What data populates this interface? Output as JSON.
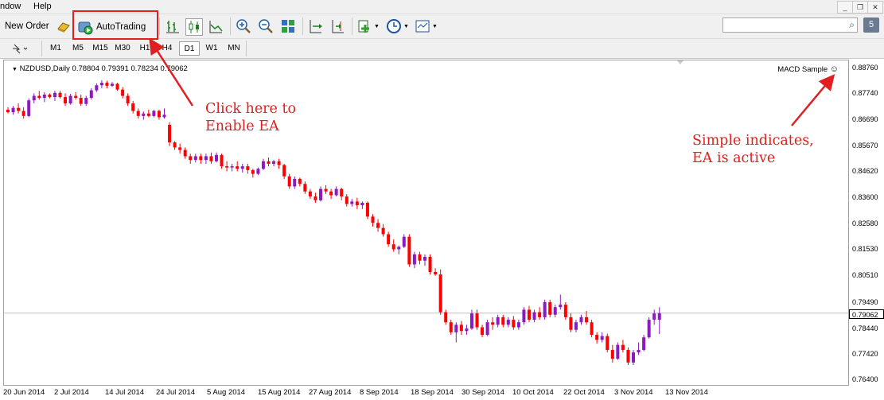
{
  "menu": {
    "items": [
      "ndow",
      "Help"
    ]
  },
  "toolbar": {
    "new_order_label": "New Order",
    "autotrading_label": "AutoTrading",
    "icons": [
      "gold-bars-icon",
      "bar-chart-icon",
      "candlestick-chart-icon",
      "line-chart-icon",
      "zoom-in-icon",
      "zoom-out-icon",
      "tile-windows-icon",
      "chart-shift-icon",
      "autoscroll-icon",
      "indicators-icon",
      "periods-clock-icon",
      "templates-icon"
    ],
    "search_placeholder": "",
    "notification_count": "5"
  },
  "timeframes": {
    "items": [
      "M1",
      "M5",
      "M15",
      "M30",
      "H1",
      "H4",
      "D1",
      "W1",
      "MN"
    ],
    "active": "D1"
  },
  "chart": {
    "symbol_info": "NZDUSD,Daily  0.78804  0.79391  0.78234  0.79062",
    "ea_label": "MACD Sample",
    "current_price": "0.79062",
    "colors": {
      "up": "#8b1ac2",
      "down": "#ff0000",
      "price_line": "#c0c0c0"
    }
  },
  "x_axis_labels": [
    "20 Jun 2014",
    "2 Jul 2014",
    "14 Jul 2014",
    "24 Jul 2014",
    "5 Aug 2014",
    "15 Aug 2014",
    "27 Aug 2014",
    "8 Sep 2014",
    "18 Sep 2014",
    "30 Sep 2014",
    "10 Oct 2014",
    "22 Oct 2014",
    "3 Nov 2014",
    "13 Nov 2014"
  ],
  "y_axis_labels": [
    "0.88760",
    "0.87740",
    "0.86690",
    "0.85670",
    "0.84620",
    "0.83600",
    "0.82580",
    "0.81530",
    "0.80510",
    "0.79490",
    "0.78440",
    "0.77420",
    "0.76400"
  ],
  "annotations": {
    "click_here_line1": "Click here to",
    "click_here_line2": "Enable EA",
    "simple_line1": "Simple indicates,",
    "simple_line2": "EA is active"
  },
  "candles": [
    [
      0.8715,
      0.8725,
      0.87,
      0.8705
    ],
    [
      0.8705,
      0.873,
      0.8695,
      0.8722
    ],
    [
      0.8722,
      0.874,
      0.87,
      0.871
    ],
    [
      0.871,
      0.8725,
      0.868,
      0.869
    ],
    [
      0.869,
      0.876,
      0.8685,
      0.8752
    ],
    [
      0.8752,
      0.878,
      0.874,
      0.877
    ],
    [
      0.877,
      0.879,
      0.8755,
      0.8762
    ],
    [
      0.8762,
      0.8785,
      0.8745,
      0.8775
    ],
    [
      0.8775,
      0.878,
      0.876,
      0.8765
    ],
    [
      0.8765,
      0.879,
      0.875,
      0.8782
    ],
    [
      0.8782,
      0.879,
      0.876,
      0.8765
    ],
    [
      0.8765,
      0.878,
      0.873,
      0.874
    ],
    [
      0.874,
      0.8778,
      0.8735,
      0.877
    ],
    [
      0.877,
      0.8785,
      0.8755,
      0.8762
    ],
    [
      0.8762,
      0.8775,
      0.873,
      0.8738
    ],
    [
      0.8738,
      0.877,
      0.873,
      0.8762
    ],
    [
      0.8762,
      0.88,
      0.8755,
      0.8792
    ],
    [
      0.8792,
      0.882,
      0.8785,
      0.8812
    ],
    [
      0.8812,
      0.8832,
      0.88,
      0.8822
    ],
    [
      0.8822,
      0.883,
      0.88,
      0.881
    ],
    [
      0.881,
      0.8825,
      0.8805,
      0.8818
    ],
    [
      0.8818,
      0.8822,
      0.879,
      0.8795
    ],
    [
      0.8795,
      0.8805,
      0.876,
      0.877
    ],
    [
      0.877,
      0.878,
      0.873,
      0.874
    ],
    [
      0.874,
      0.875,
      0.87,
      0.871
    ],
    [
      0.871,
      0.872,
      0.868,
      0.869
    ],
    [
      0.869,
      0.8708,
      0.8675,
      0.87
    ],
    [
      0.87,
      0.8715,
      0.8685,
      0.869
    ],
    [
      0.869,
      0.8715,
      0.8685,
      0.871
    ],
    [
      0.871,
      0.8715,
      0.8675,
      0.8685
    ],
    [
      0.8685,
      0.872,
      0.868,
      0.8695
    ],
    [
      0.8655,
      0.8665,
      0.857,
      0.8585
    ],
    [
      0.8585,
      0.859,
      0.8555,
      0.8565
    ],
    [
      0.8565,
      0.858,
      0.854,
      0.8555
    ],
    [
      0.8555,
      0.8565,
      0.852,
      0.853
    ],
    [
      0.853,
      0.854,
      0.85,
      0.8515
    ],
    [
      0.8515,
      0.854,
      0.8505,
      0.853
    ],
    [
      0.853,
      0.854,
      0.85,
      0.8515
    ],
    [
      0.8515,
      0.854,
      0.85,
      0.853
    ],
    [
      0.853,
      0.8545,
      0.85,
      0.851
    ],
    [
      0.851,
      0.8545,
      0.8505,
      0.8535
    ],
    [
      0.8535,
      0.854,
      0.848,
      0.849
    ],
    [
      0.849,
      0.851,
      0.847,
      0.8485
    ],
    [
      0.8485,
      0.85,
      0.847,
      0.849
    ],
    [
      0.849,
      0.851,
      0.847,
      0.848
    ],
    [
      0.848,
      0.85,
      0.8465,
      0.849
    ],
    [
      0.849,
      0.85,
      0.846,
      0.8475
    ],
    [
      0.8475,
      0.848,
      0.8445,
      0.846
    ],
    [
      0.846,
      0.8485,
      0.8455,
      0.848
    ],
    [
      0.848,
      0.852,
      0.8475,
      0.851
    ],
    [
      0.851,
      0.8525,
      0.849,
      0.85
    ],
    [
      0.85,
      0.8515,
      0.849,
      0.851
    ],
    [
      0.851,
      0.852,
      0.848,
      0.8495
    ],
    [
      0.8495,
      0.85,
      0.844,
      0.845
    ],
    [
      0.845,
      0.846,
      0.84,
      0.841
    ],
    [
      0.841,
      0.845,
      0.84,
      0.844
    ],
    [
      0.844,
      0.8445,
      0.841,
      0.842
    ],
    [
      0.842,
      0.843,
      0.838,
      0.839
    ],
    [
      0.839,
      0.84,
      0.836,
      0.837
    ],
    [
      0.837,
      0.8385,
      0.8345,
      0.8355
    ],
    [
      0.8355,
      0.841,
      0.835,
      0.84
    ],
    [
      0.84,
      0.8415,
      0.838,
      0.839
    ],
    [
      0.839,
      0.84,
      0.836,
      0.8375
    ],
    [
      0.8375,
      0.841,
      0.837,
      0.84
    ],
    [
      0.84,
      0.8405,
      0.8355,
      0.837
    ],
    [
      0.837,
      0.838,
      0.833,
      0.834
    ],
    [
      0.834,
      0.836,
      0.833,
      0.835
    ],
    [
      0.835,
      0.8365,
      0.832,
      0.8335
    ],
    [
      0.8335,
      0.835,
      0.832,
      0.8345
    ],
    [
      0.8345,
      0.835,
      0.828,
      0.829
    ],
    [
      0.829,
      0.83,
      0.825,
      0.8265
    ],
    [
      0.8265,
      0.828,
      0.823,
      0.8245
    ],
    [
      0.8245,
      0.826,
      0.821,
      0.822
    ],
    [
      0.822,
      0.823,
      0.817,
      0.818
    ],
    [
      0.818,
      0.82,
      0.815,
      0.816
    ],
    [
      0.816,
      0.8175,
      0.814,
      0.817
    ],
    [
      0.817,
      0.822,
      0.8165,
      0.821
    ],
    [
      0.821,
      0.822,
      0.809,
      0.81
    ],
    [
      0.81,
      0.815,
      0.8085,
      0.814
    ],
    [
      0.814,
      0.815,
      0.81,
      0.8115
    ],
    [
      0.8115,
      0.814,
      0.8095,
      0.813
    ],
    [
      0.813,
      0.814,
      0.806,
      0.807
    ],
    [
      0.807,
      0.8085,
      0.8055,
      0.806
    ],
    [
      0.806,
      0.808,
      0.79,
      0.791
    ],
    [
      0.791,
      0.792,
      0.786,
      0.787
    ],
    [
      0.787,
      0.788,
      0.782,
      0.783
    ],
    [
      0.783,
      0.787,
      0.779,
      0.786
    ],
    [
      0.786,
      0.7875,
      0.782,
      0.7835
    ],
    [
      0.7835,
      0.786,
      0.782,
      0.7845
    ],
    [
      0.7845,
      0.792,
      0.784,
      0.7905
    ],
    [
      0.7905,
      0.792,
      0.784,
      0.785
    ],
    [
      0.785,
      0.786,
      0.781,
      0.782
    ],
    [
      0.782,
      0.788,
      0.7815,
      0.787
    ],
    [
      0.787,
      0.789,
      0.784,
      0.786
    ],
    [
      0.786,
      0.79,
      0.785,
      0.789
    ],
    [
      0.789,
      0.79,
      0.785,
      0.786
    ],
    [
      0.786,
      0.789,
      0.785,
      0.788
    ],
    [
      0.788,
      0.7895,
      0.784,
      0.785
    ],
    [
      0.785,
      0.788,
      0.784,
      0.787
    ],
    [
      0.787,
      0.793,
      0.786,
      0.792
    ],
    [
      0.792,
      0.7935,
      0.787,
      0.788
    ],
    [
      0.788,
      0.792,
      0.787,
      0.791
    ],
    [
      0.791,
      0.793,
      0.788,
      0.789
    ],
    [
      0.789,
      0.796,
      0.788,
      0.795
    ],
    [
      0.795,
      0.796,
      0.789,
      0.79
    ],
    [
      0.79,
      0.794,
      0.789,
      0.793
    ],
    [
      0.793,
      0.798,
      0.792,
      0.794
    ],
    [
      0.794,
      0.795,
      0.788,
      0.789
    ],
    [
      0.789,
      0.7905,
      0.783,
      0.784
    ],
    [
      0.784,
      0.788,
      0.783,
      0.787
    ],
    [
      0.787,
      0.79,
      0.786,
      0.789
    ],
    [
      0.789,
      0.7915,
      0.786,
      0.787
    ],
    [
      0.787,
      0.788,
      0.781,
      0.782
    ],
    [
      0.782,
      0.783,
      0.7785,
      0.78
    ],
    [
      0.78,
      0.783,
      0.779,
      0.7815
    ],
    [
      0.7815,
      0.7825,
      0.775,
      0.776
    ],
    [
      0.776,
      0.778,
      0.771,
      0.7725
    ],
    [
      0.7725,
      0.779,
      0.772,
      0.778
    ],
    [
      0.778,
      0.78,
      0.775,
      0.776
    ],
    [
      0.776,
      0.777,
      0.77,
      0.771
    ],
    [
      0.771,
      0.776,
      0.77,
      0.775
    ],
    [
      0.775,
      0.779,
      0.774,
      0.776
    ],
    [
      0.776,
      0.782,
      0.7755,
      0.781
    ],
    [
      0.781,
      0.789,
      0.7805,
      0.788
    ],
    [
      0.788,
      0.792,
      0.786,
      0.7905
    ],
    [
      0.788,
      0.793,
      0.7823,
      0.7906
    ]
  ]
}
